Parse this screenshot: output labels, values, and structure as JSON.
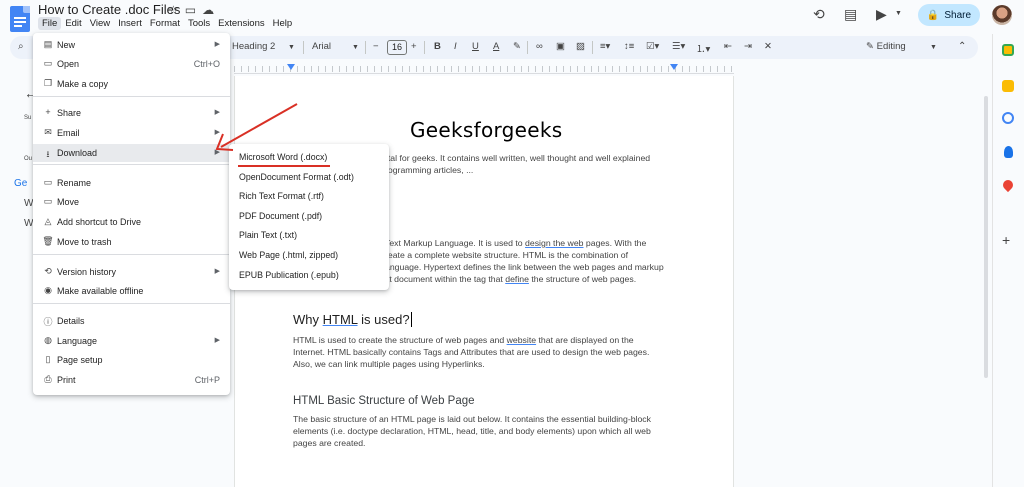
{
  "window": {
    "doc_title": "How to Create .doc Files",
    "menus": [
      "File",
      "Edit",
      "View",
      "Insert",
      "Format",
      "Tools",
      "Extensions",
      "Help"
    ],
    "share_label": "Share"
  },
  "toolbar": {
    "style": "Heading 2",
    "font": "Arial",
    "font_size": "16",
    "mode": "Editing"
  },
  "left_panel": {
    "items": [
      "Su",
      "Ou",
      "Ge",
      "W",
      "W"
    ]
  },
  "file_menu": {
    "items": [
      {
        "label": "New",
        "icon": "new-doc-icon",
        "glyph": "▤",
        "shortcut": "",
        "submenu": true
      },
      {
        "label": "Open",
        "icon": "folder-icon",
        "glyph": "▭",
        "shortcut": "Ctrl+O",
        "submenu": false
      },
      {
        "label": "Make a copy",
        "icon": "copy-icon",
        "glyph": "❐",
        "shortcut": "",
        "submenu": false
      },
      {
        "label": "Share",
        "icon": "person-add-icon",
        "glyph": "+",
        "shortcut": "",
        "submenu": true
      },
      {
        "label": "Email",
        "icon": "mail-icon",
        "glyph": "✉",
        "shortcut": "",
        "submenu": true
      },
      {
        "label": "Download",
        "icon": "download-icon",
        "glyph": "⭳",
        "shortcut": "",
        "submenu": true
      },
      {
        "label": "Rename",
        "icon": "rename-icon",
        "glyph": "▭",
        "shortcut": "",
        "submenu": false
      },
      {
        "label": "Move",
        "icon": "move-folder-icon",
        "glyph": "▭",
        "shortcut": "",
        "submenu": false
      },
      {
        "label": "Add shortcut to Drive",
        "icon": "drive-shortcut-icon",
        "glyph": "◬",
        "shortcut": "",
        "submenu": false
      },
      {
        "label": "Move to trash",
        "icon": "trash-icon",
        "glyph": "🗑",
        "shortcut": "",
        "submenu": false
      },
      {
        "label": "Version history",
        "icon": "history-icon",
        "glyph": "⟲",
        "shortcut": "",
        "submenu": true
      },
      {
        "label": "Make available offline",
        "icon": "offline-icon",
        "glyph": "◉",
        "shortcut": "",
        "submenu": false
      },
      {
        "label": "Details",
        "icon": "info-icon",
        "glyph": "ⓘ",
        "shortcut": "",
        "submenu": false
      },
      {
        "label": "Language",
        "icon": "globe-icon",
        "glyph": "◍",
        "shortcut": "",
        "submenu": true
      },
      {
        "label": "Page setup",
        "icon": "page-setup-icon",
        "glyph": "▯",
        "shortcut": "",
        "submenu": false
      },
      {
        "label": "Print",
        "icon": "print-icon",
        "glyph": "⎙",
        "shortcut": "Ctrl+P",
        "submenu": false
      }
    ]
  },
  "download_menu": {
    "items": [
      "Microsoft Word (.docx)",
      "OpenDocument Format (.odt)",
      "Rich Text Format (.rtf)",
      "PDF Document (.pdf)",
      "Plain Text (.txt)",
      "Web Page (.html, zipped)",
      "EPUB Publication (.epub)"
    ]
  },
  "document": {
    "heading": "Geeksforgeeks",
    "intro_line1": "rtal for geeks. It contains well written, well thought and well explained",
    "intro_line2": "rogramming articles, ...",
    "html_line1_pre": "Text Markup Language. It is used to ",
    "html_line1_link": "design the web",
    "html_line1_post": " pages. With the",
    "html_line2": "reate a complete website structure. HTML is the combination of",
    "html_line3": "anguage. Hypertext defines the link between the web pages and markup",
    "html_line4_pre": "xt document within the tag that ",
    "html_line4_link": "define",
    "html_line4_post": " the structure of web pages.",
    "why_heading_pre": "Why ",
    "why_heading_link": "HTML",
    "why_heading_post": " is used?",
    "why_line1_pre": "HTML is used to create the structure of web pages and ",
    "why_line1_link": "website",
    "why_line1_post": " that are displayed on the",
    "why_line2": "Internet. HTML basically contains Tags and Attributes that are used to design the web pages.",
    "why_line3": "Also, we can link multiple pages using Hyperlinks.",
    "basic_heading": "HTML Basic Structure of Web Page",
    "basic_line1": "The basic structure of an HTML page is laid out below. It contains the essential building-block",
    "basic_line2": "elements (i.e. doctype declaration, HTML, head, title, and body elements) upon which all web",
    "basic_line3": "pages are created."
  },
  "colors": {
    "accent": "#4285f4",
    "share_bg": "#c2e7ff",
    "annotation_red": "#d93025"
  }
}
